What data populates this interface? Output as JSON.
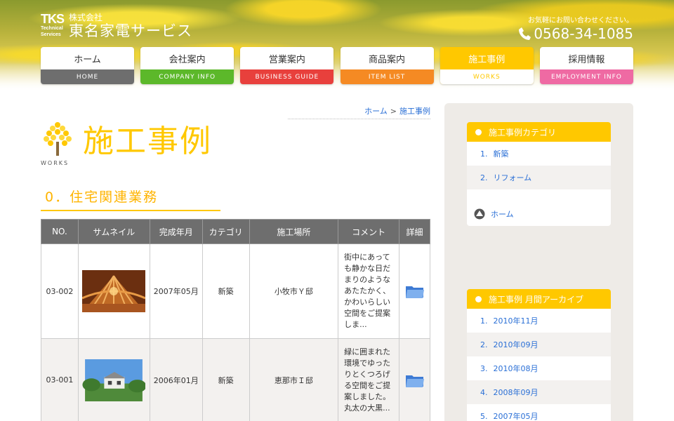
{
  "header": {
    "logo_mark": "TKS",
    "logo_sub": "Technical Services",
    "company_prefix": "株式会社",
    "company_name": "東名家電サービス",
    "contact_msg": "お気軽にお問い合わせください。",
    "phone": "0568-34-1085"
  },
  "nav": [
    {
      "jp": "ホーム",
      "en": "HOME",
      "color": "#6e6e6e"
    },
    {
      "jp": "会社案内",
      "en": "COMPANY INFO",
      "color": "#5cb82a"
    },
    {
      "jp": "営業案内",
      "en": "BUSINESS GUIDE",
      "color": "#e8403c"
    },
    {
      "jp": "商品案内",
      "en": "ITEM LIST",
      "color": "#f58a23"
    },
    {
      "jp": "施工事例",
      "en": "WORKS",
      "color": "#ffc800"
    },
    {
      "jp": "採用情報",
      "en": "EMPLOYMENT INFO",
      "color": "#ef6aa3"
    }
  ],
  "breadcrumb": {
    "home": "ホーム",
    "sep": ">",
    "current": "施工事例"
  },
  "page": {
    "icon_label": "WORKS",
    "title": "施工事例",
    "section": "0．住宅関連業務"
  },
  "table": {
    "headers": [
      "NO.",
      "サムネイル",
      "完成年月",
      "カテゴリ",
      "施工場所",
      "コメント",
      "詳細"
    ],
    "rows": [
      {
        "no": "03-002",
        "date": "2007年05月",
        "category": "新築",
        "place": "小牧市Ｙ邸",
        "comment": "街中にあっても静かな日だまりのようなあたたかく、かわいらしい空間をご提案しま..."
      },
      {
        "no": "03-001",
        "date": "2006年01月",
        "category": "新築",
        "place": "恵那市Ｉ邸",
        "comment": "緑に囲まれた環境でゆったりとくつろげる空間をご提案しました。丸太の大黒..."
      }
    ]
  },
  "sidebar": {
    "categories_title": "施工事例カテゴリ",
    "categories": [
      {
        "num": "1.",
        "label": "新築"
      },
      {
        "num": "2.",
        "label": "リフォーム"
      }
    ],
    "home_label": "ホーム",
    "archive_title": "施工事例 月間アーカイブ",
    "archive": [
      {
        "num": "1.",
        "label": "2010年11月"
      },
      {
        "num": "2.",
        "label": "2010年09月"
      },
      {
        "num": "3.",
        "label": "2010年08月"
      },
      {
        "num": "4.",
        "label": "2008年09月"
      },
      {
        "num": "5.",
        "label": "2007年05月"
      }
    ]
  }
}
